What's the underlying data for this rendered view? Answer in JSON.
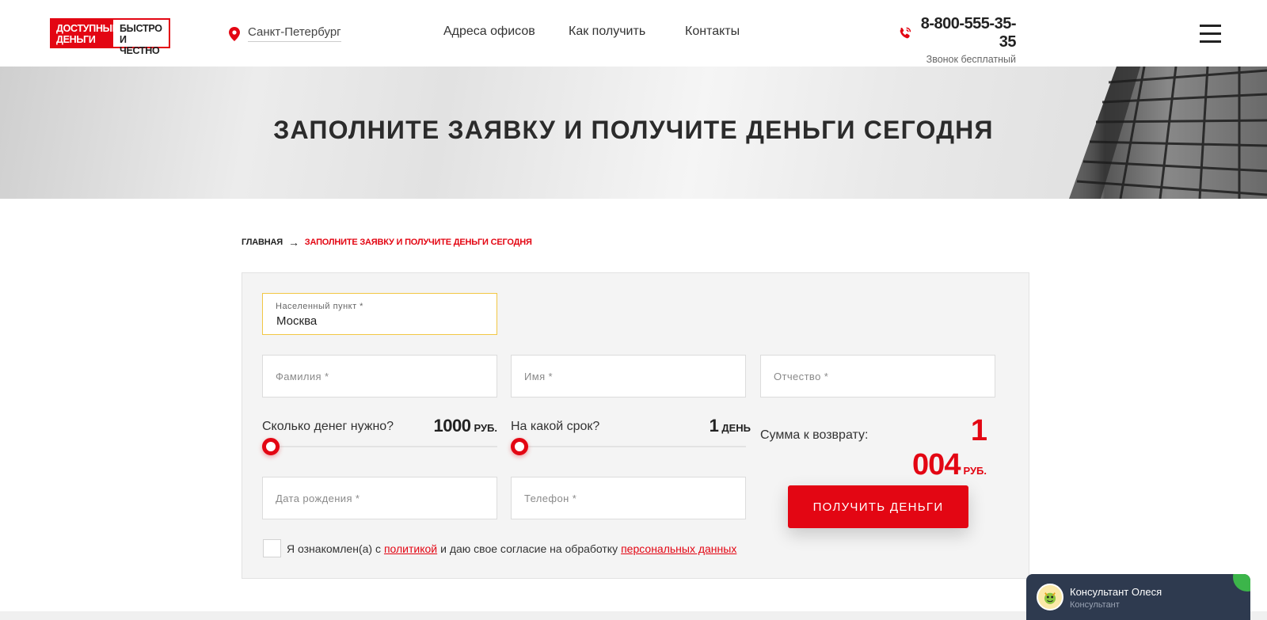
{
  "header": {
    "logo": {
      "left_line1": "ДОСТУПНЫЕ",
      "left_line2": "ДЕНЬГИ",
      "right_line1": "БЫСТРО",
      "right_line2": "И ЧЕСТНО"
    },
    "city": "Санкт-Петербург",
    "nav": [
      "Адреса офисов",
      "Как получить",
      "Контакты"
    ],
    "phone": "8-800-555-35-35",
    "phone_note": "Звонок бесплатный"
  },
  "hero": {
    "title": "ЗАПОЛНИТЕ ЗАЯВКУ И ПОЛУЧИТЕ ДЕНЬГИ СЕГОДНЯ"
  },
  "breadcrumb": {
    "home": "ГЛАВНАЯ",
    "arrow": "→",
    "current": "ЗАПОЛНИТЕ ЗАЯВКУ И ПОЛУЧИТЕ ДЕНЬГИ СЕГОДНЯ"
  },
  "form": {
    "city_field": {
      "label": "Населенный пункт *",
      "value": "Москва"
    },
    "surname_placeholder": "Фамилия *",
    "name_placeholder": "Имя *",
    "patronymic_placeholder": "Отчество *",
    "amount": {
      "label": "Сколько денег нужно?",
      "value": "1000",
      "unit": "РУБ.",
      "position": 0
    },
    "term": {
      "label": "На какой срок?",
      "value": "1",
      "unit": "ДЕНЬ",
      "position": 0
    },
    "total": {
      "label": "Сумма к возврату:",
      "value": "1 004",
      "unit": "РУБ."
    },
    "birthdate_placeholder": "Дата рождения *",
    "phone_placeholder": "Телефон *",
    "submit_label": "ПОЛУЧИТЬ ДЕНЬГИ",
    "consent": {
      "text_before": "Я ознакомлен(а) с",
      "policy_link": "политикой",
      "text_middle": "и даю свое согласие на обработку",
      "data_link": "персональных данных",
      "checked": false
    }
  },
  "chat": {
    "name": "Консультант Олеся",
    "role": "Консультант"
  },
  "colors": {
    "accent": "#e30613",
    "chat_bg": "#2e3a4f",
    "online": "#3cb54a",
    "city_border": "#f2c744"
  }
}
